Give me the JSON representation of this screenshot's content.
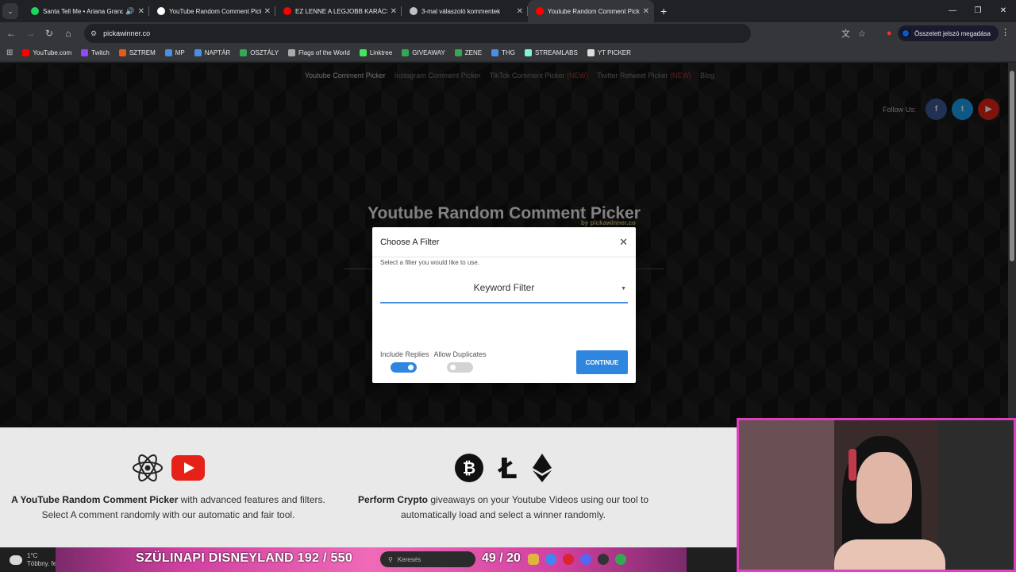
{
  "browser": {
    "tabs": [
      {
        "title": "Santa Tell Me • Ariana Grande",
        "color": "#1ed760",
        "audio": true
      },
      {
        "title": "YouTube Random Comment Picker",
        "color": "#ffffff",
        "audio": false
      },
      {
        "title": "EZ LENNE A LEGJOBB KARÁCSONY",
        "color": "#ff0000",
        "audio": false
      },
      {
        "title": "3-mal válaszoló kommentek",
        "color": "#bdc1c6",
        "audio": false
      },
      {
        "title": "Youtube Random Comment Picker",
        "color": "#ff0000",
        "audio": false,
        "active": true
      }
    ],
    "url": "pickawinner.co",
    "profile_label": "Összetett jelszó megadása",
    "bookmarks": [
      {
        "label": "YouTube.com",
        "color": "#ff0000"
      },
      {
        "label": "Twitch",
        "color": "#9146ff"
      },
      {
        "label": "SZTREM",
        "color": "#e25a1c"
      },
      {
        "label": "MP",
        "color": "#4a8fe2"
      },
      {
        "label": "NAPTÁR",
        "color": "#4a8fe2"
      },
      {
        "label": "OSZTÁLY",
        "color": "#34a853"
      },
      {
        "label": "Flags of the World",
        "color": "#aaaaaa"
      },
      {
        "label": "Linktree",
        "color": "#43e660"
      },
      {
        "label": "GIVEAWAY",
        "color": "#34a853"
      },
      {
        "label": "ZENE",
        "color": "#34a853"
      },
      {
        "label": "THG",
        "color": "#4a8fe2"
      },
      {
        "label": "STREAMLABS",
        "color": "#80f5d2"
      },
      {
        "label": "YT PICKER",
        "color": "#dddddd"
      }
    ]
  },
  "site": {
    "nav": {
      "youtube": "Youtube Comment Picker",
      "instagram": "Instagram Comment Picker",
      "tiktok": "TikTok Comment Picker",
      "tiktok_badge": "(NEW)",
      "twitter": "Twitter Retweet Picker",
      "twitter_badge": "(NEW)",
      "blog": "Blog"
    },
    "follow_label": "Follow Us:",
    "hero_title": "Youtube Random Comment Picker",
    "hero_by": "by pickawinner.co",
    "feature1": {
      "bold": "A YouTube Random Comment Picker",
      "line1": " with advanced features and filters.",
      "line2": "Select A comment randomly with our automatic and fair tool."
    },
    "feature2": {
      "bold": "Perform Crypto",
      "line1": " giveaways on your Youtube Videos using our tool to",
      "line2": "automatically load and select a winner randomly."
    }
  },
  "modal": {
    "title": "Choose A Filter",
    "help": "Select a filter you would like to use.",
    "selected_filter": "Keyword Filter",
    "include_replies_label": "Include Replies",
    "include_replies_on": true,
    "allow_duplicates_label": "Allow Duplicates",
    "allow_duplicates_on": false,
    "continue_label": "CONTINUE"
  },
  "taskbar": {
    "weather_temp": "1°C",
    "weather_desc": "Többny. felhős",
    "search_placeholder": "Keresés"
  },
  "stream_overlay": {
    "banner": "SZÜLINAPI DISNEYLAND  192  /  550",
    "counter": "49 / 20"
  },
  "colors": {
    "accent": "#2f86df",
    "facebook": "#3b5998",
    "twitter": "#1da1f2",
    "youtube": "#e62117"
  }
}
